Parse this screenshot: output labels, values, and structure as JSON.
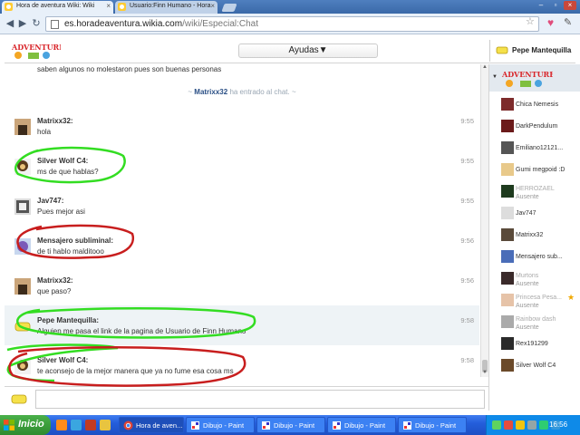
{
  "browser": {
    "tabs": [
      {
        "title": "Hora de aventura Wiki: Wiki",
        "active": true
      },
      {
        "title": "Usuario:Finn Humano - Hora",
        "active": false
      }
    ],
    "url_host": "es.horadeaventura.wikia.com",
    "url_path": "/wiki/Especial:Chat"
  },
  "chat": {
    "header": {
      "logo_text": "ADVENTURE TIME",
      "channel_dropdown": "Ayudas▼",
      "current_user": "Pepe Mantequilla"
    },
    "scrolled_text": "saben algunos no molestaron pues son buenas personas",
    "system_message": {
      "user": "Matrixx32",
      "text": "ha entrado al chat.",
      "prefix": "~",
      "suffix": "~"
    },
    "messages": [
      {
        "user": "Matrixx32:",
        "text": "hola",
        "time": "9:55"
      },
      {
        "user": "Silver Wolf C4:",
        "text": "ms de que hablas?",
        "time": "9:55"
      },
      {
        "user": "Jav747:",
        "text": "Pues mejor asi",
        "time": "9:55"
      },
      {
        "user": "Mensajero subliminal:",
        "text": "de ti hablo malditooo",
        "time": "9:56"
      },
      {
        "user": "Matrixx32:",
        "text": "que paso?",
        "time": "9:56"
      },
      {
        "user": "Pepe Mantequilla:",
        "text": "Alguien me pasa el link de la pagina de Usuario de Finn Humano",
        "time": "9:58"
      },
      {
        "user": "Silver Wolf C4:",
        "text": "te aconsejo de la mejor manera que ya no fume esa cosa ms",
        "time": "9:58"
      }
    ]
  },
  "userlist": [
    {
      "name": "Chica Nemesis",
      "status": ""
    },
    {
      "name": "DarkPendulum",
      "status": ""
    },
    {
      "name": "Emiliano12121...",
      "status": ""
    },
    {
      "name": "Gumi megpoid :D",
      "status": ""
    },
    {
      "name": "HERROZAEL",
      "status": "Ausente"
    },
    {
      "name": "Jav747",
      "status": ""
    },
    {
      "name": "Matrixx32",
      "status": ""
    },
    {
      "name": "Mensajero sub...",
      "status": ""
    },
    {
      "name": "Murtons",
      "status": "Ausente"
    },
    {
      "name": "Princesa Pesa...",
      "status": "Ausente"
    },
    {
      "name": "Rainbow dash",
      "status": "Ausente"
    },
    {
      "name": "Rex191299",
      "status": ""
    },
    {
      "name": "Silver Wolf C4",
      "status": ""
    }
  ],
  "taskbar": {
    "start_label": "Inicio",
    "tasks": [
      "Hora de aven...",
      "Dibujo - Paint",
      "Dibujo - Paint",
      "Dibujo - Paint",
      "Dibujo - Paint"
    ],
    "clock": "16:56"
  },
  "colors": {
    "accent": "#2a4f85",
    "green_marker": "#33dd22",
    "red_marker": "#c81e1e"
  }
}
